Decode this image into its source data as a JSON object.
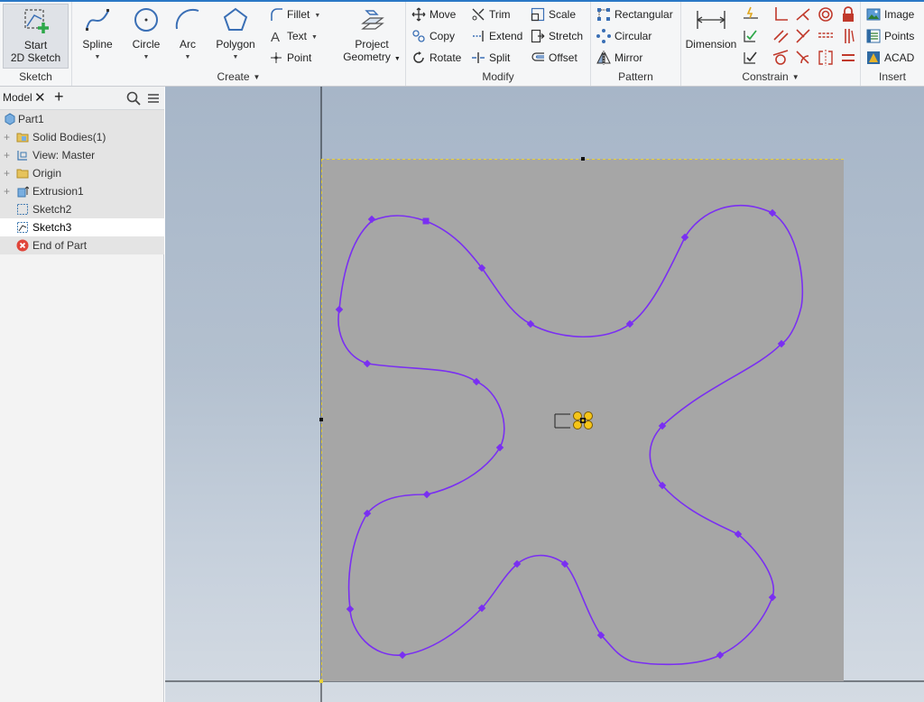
{
  "ribbon": {
    "sketch": {
      "label": "Sketch",
      "start_label_1": "Start",
      "start_label_2": "2D Sketch"
    },
    "create": {
      "label": "Create",
      "spline": "Spline",
      "circle": "Circle",
      "arc": "Arc",
      "polygon": "Polygon",
      "fillet": "Fillet",
      "text": "Text",
      "point": "Point",
      "project_1": "Project",
      "project_2": "Geometry"
    },
    "modify": {
      "label": "Modify",
      "move": "Move",
      "copy": "Copy",
      "rotate": "Rotate",
      "trim": "Trim",
      "extend": "Extend",
      "split": "Split",
      "scale": "Scale",
      "stretch": "Stretch",
      "offset": "Offset"
    },
    "pattern": {
      "label": "Pattern",
      "rectangular": "Rectangular",
      "circular": "Circular",
      "mirror": "Mirror"
    },
    "constrain": {
      "label": "Constrain",
      "dimension": "Dimension"
    },
    "insert": {
      "label": "Insert",
      "image": "Image",
      "points": "Points",
      "acad": "ACAD"
    }
  },
  "browser": {
    "tab_label": "Model",
    "nodes": [
      {
        "label": "Part1"
      },
      {
        "label": "Solid Bodies(1)"
      },
      {
        "label": "View: Master"
      },
      {
        "label": "Origin"
      },
      {
        "label": "Extrusion1"
      },
      {
        "label": "Sketch2"
      },
      {
        "label": "Sketch3"
      },
      {
        "label": "End of Part"
      }
    ]
  },
  "colors": {
    "spline": "#7a2ff2",
    "sheet": "#a6a6a6",
    "accent": "#2a78c6",
    "end_of_part": "#e0453a",
    "origin_marker": "#f5c518"
  },
  "viewport": {
    "sketch_active": "Sketch3"
  }
}
